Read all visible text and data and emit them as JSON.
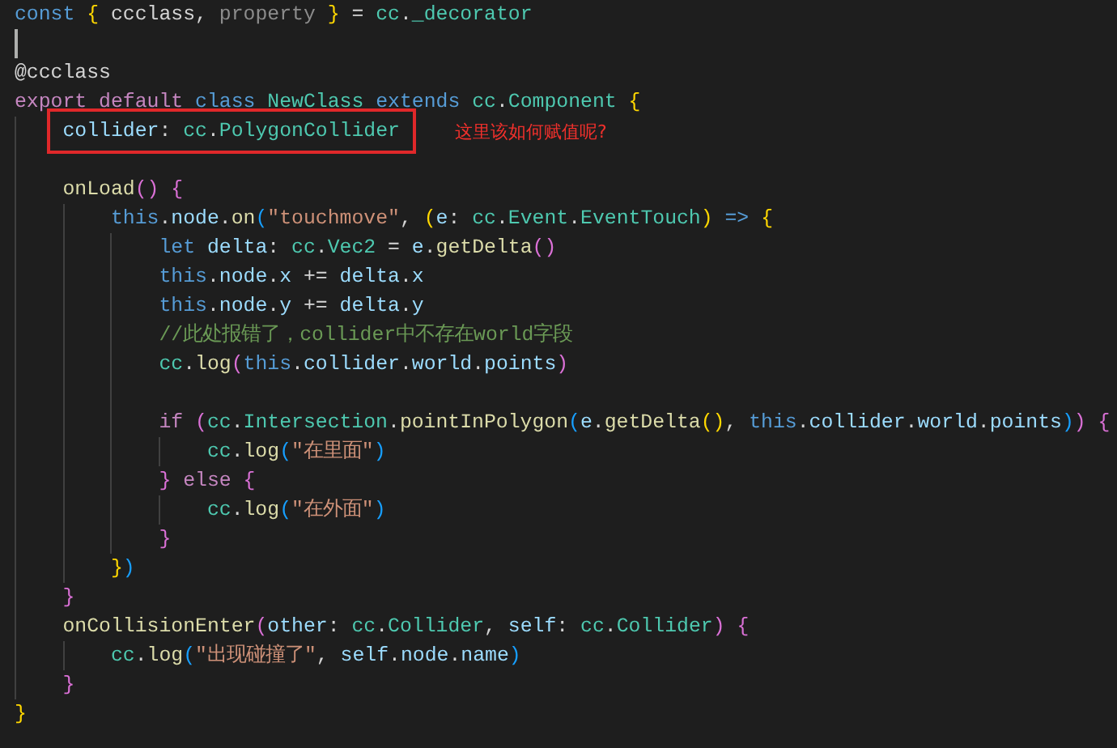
{
  "editor": {
    "lines": [
      {
        "tokens": [
          {
            "kind": "kw",
            "text": "const "
          },
          {
            "kind": "b1",
            "text": "{"
          },
          {
            "kind": "plain",
            "text": " ccclass, "
          },
          {
            "kind": "dim",
            "text": "property"
          },
          {
            "kind": "b1",
            "text": " }"
          },
          {
            "kind": "plain",
            "text": " = "
          },
          {
            "kind": "type",
            "text": "cc"
          },
          {
            "kind": "plain",
            "text": "."
          },
          {
            "kind": "type",
            "text": "_decorator"
          }
        ]
      },
      {
        "cursor": true
      },
      {
        "tokens": [
          {
            "kind": "plain",
            "text": "@ccclass"
          }
        ]
      },
      {
        "tokens": [
          {
            "kind": "ctrl",
            "text": "export default "
          },
          {
            "kind": "kw",
            "text": "class "
          },
          {
            "kind": "type",
            "text": "NewClass "
          },
          {
            "kind": "kw",
            "text": "extends "
          },
          {
            "kind": "type",
            "text": "cc"
          },
          {
            "kind": "plain",
            "text": "."
          },
          {
            "kind": "type",
            "text": "Component "
          },
          {
            "kind": "b1",
            "text": "{"
          }
        ]
      },
      {
        "marked": true,
        "note": "这里该如何赋值呢?",
        "tokens": [
          {
            "kind": "indent"
          },
          {
            "kind": "var",
            "text": "collider"
          },
          {
            "kind": "plain",
            "text": ": "
          },
          {
            "kind": "type",
            "text": "cc"
          },
          {
            "kind": "plain",
            "text": "."
          },
          {
            "kind": "type",
            "text": "PolygonCollider"
          }
        ]
      },
      {
        "tokens": [
          {
            "kind": "indent"
          }
        ]
      },
      {
        "tokens": [
          {
            "kind": "indent"
          },
          {
            "kind": "fn",
            "text": "onLoad"
          },
          {
            "kind": "b2",
            "text": "() {"
          }
        ]
      },
      {
        "tokens": [
          {
            "kind": "indent"
          },
          {
            "kind": "indent"
          },
          {
            "kind": "kw",
            "text": "this"
          },
          {
            "kind": "plain",
            "text": "."
          },
          {
            "kind": "var",
            "text": "node"
          },
          {
            "kind": "plain",
            "text": "."
          },
          {
            "kind": "fn",
            "text": "on"
          },
          {
            "kind": "b3",
            "text": "("
          },
          {
            "kind": "str",
            "text": "\"touchmove\""
          },
          {
            "kind": "plain",
            "text": ", "
          },
          {
            "kind": "b1",
            "text": "("
          },
          {
            "kind": "var",
            "text": "e"
          },
          {
            "kind": "plain",
            "text": ": "
          },
          {
            "kind": "type",
            "text": "cc"
          },
          {
            "kind": "plain",
            "text": "."
          },
          {
            "kind": "type",
            "text": "Event"
          },
          {
            "kind": "plain",
            "text": "."
          },
          {
            "kind": "type",
            "text": "EventTouch"
          },
          {
            "kind": "b1",
            "text": ") "
          },
          {
            "kind": "kw",
            "text": "=> "
          },
          {
            "kind": "b1",
            "text": "{"
          }
        ]
      },
      {
        "tokens": [
          {
            "kind": "indent"
          },
          {
            "kind": "indent"
          },
          {
            "kind": "indent"
          },
          {
            "kind": "kw",
            "text": "let "
          },
          {
            "kind": "var",
            "text": "delta"
          },
          {
            "kind": "plain",
            "text": ": "
          },
          {
            "kind": "type",
            "text": "cc"
          },
          {
            "kind": "plain",
            "text": "."
          },
          {
            "kind": "type",
            "text": "Vec2"
          },
          {
            "kind": "plain",
            "text": " = "
          },
          {
            "kind": "var",
            "text": "e"
          },
          {
            "kind": "plain",
            "text": "."
          },
          {
            "kind": "fn",
            "text": "getDelta"
          },
          {
            "kind": "b2",
            "text": "()"
          }
        ]
      },
      {
        "tokens": [
          {
            "kind": "indent"
          },
          {
            "kind": "indent"
          },
          {
            "kind": "indent"
          },
          {
            "kind": "kw",
            "text": "this"
          },
          {
            "kind": "plain",
            "text": "."
          },
          {
            "kind": "var",
            "text": "node"
          },
          {
            "kind": "plain",
            "text": "."
          },
          {
            "kind": "var",
            "text": "x"
          },
          {
            "kind": "plain",
            "text": " += "
          },
          {
            "kind": "var",
            "text": "delta"
          },
          {
            "kind": "plain",
            "text": "."
          },
          {
            "kind": "var",
            "text": "x"
          }
        ]
      },
      {
        "tokens": [
          {
            "kind": "indent"
          },
          {
            "kind": "indent"
          },
          {
            "kind": "indent"
          },
          {
            "kind": "kw",
            "text": "this"
          },
          {
            "kind": "plain",
            "text": "."
          },
          {
            "kind": "var",
            "text": "node"
          },
          {
            "kind": "plain",
            "text": "."
          },
          {
            "kind": "var",
            "text": "y"
          },
          {
            "kind": "plain",
            "text": " += "
          },
          {
            "kind": "var",
            "text": "delta"
          },
          {
            "kind": "plain",
            "text": "."
          },
          {
            "kind": "var",
            "text": "y"
          }
        ]
      },
      {
        "tokens": [
          {
            "kind": "indent"
          },
          {
            "kind": "indent"
          },
          {
            "kind": "indent"
          },
          {
            "kind": "cmt",
            "text": "//此处报错了，collider中不存在world字段"
          }
        ]
      },
      {
        "tokens": [
          {
            "kind": "indent"
          },
          {
            "kind": "indent"
          },
          {
            "kind": "indent"
          },
          {
            "kind": "type",
            "text": "cc"
          },
          {
            "kind": "plain",
            "text": "."
          },
          {
            "kind": "fn",
            "text": "log"
          },
          {
            "kind": "b2",
            "text": "("
          },
          {
            "kind": "kw",
            "text": "this"
          },
          {
            "kind": "plain",
            "text": "."
          },
          {
            "kind": "var",
            "text": "collider"
          },
          {
            "kind": "plain",
            "text": "."
          },
          {
            "kind": "var",
            "text": "world"
          },
          {
            "kind": "plain",
            "text": "."
          },
          {
            "kind": "var",
            "text": "points"
          },
          {
            "kind": "b2",
            "text": ")"
          }
        ]
      },
      {
        "tokens": [
          {
            "kind": "indent"
          },
          {
            "kind": "indent"
          },
          {
            "kind": "indent"
          }
        ]
      },
      {
        "tokens": [
          {
            "kind": "indent"
          },
          {
            "kind": "indent"
          },
          {
            "kind": "indent"
          },
          {
            "kind": "ctrl",
            "text": "if "
          },
          {
            "kind": "b2",
            "text": "("
          },
          {
            "kind": "type",
            "text": "cc"
          },
          {
            "kind": "plain",
            "text": "."
          },
          {
            "kind": "type",
            "text": "Intersection"
          },
          {
            "kind": "plain",
            "text": "."
          },
          {
            "kind": "fn",
            "text": "pointInPolygon"
          },
          {
            "kind": "b3",
            "text": "("
          },
          {
            "kind": "var",
            "text": "e"
          },
          {
            "kind": "plain",
            "text": "."
          },
          {
            "kind": "fn",
            "text": "getDelta"
          },
          {
            "kind": "b1",
            "text": "()"
          },
          {
            "kind": "plain",
            "text": ", "
          },
          {
            "kind": "kw",
            "text": "this"
          },
          {
            "kind": "plain",
            "text": "."
          },
          {
            "kind": "var",
            "text": "collider"
          },
          {
            "kind": "plain",
            "text": "."
          },
          {
            "kind": "var",
            "text": "world"
          },
          {
            "kind": "plain",
            "text": "."
          },
          {
            "kind": "var",
            "text": "points"
          },
          {
            "kind": "b3",
            "text": ")"
          },
          {
            "kind": "b2",
            "text": ") {"
          }
        ]
      },
      {
        "tokens": [
          {
            "kind": "indent"
          },
          {
            "kind": "indent"
          },
          {
            "kind": "indent"
          },
          {
            "kind": "indent"
          },
          {
            "kind": "type",
            "text": "cc"
          },
          {
            "kind": "plain",
            "text": "."
          },
          {
            "kind": "fn",
            "text": "log"
          },
          {
            "kind": "b3",
            "text": "("
          },
          {
            "kind": "str",
            "text": "\"在里面\""
          },
          {
            "kind": "b3",
            "text": ")"
          }
        ]
      },
      {
        "tokens": [
          {
            "kind": "indent"
          },
          {
            "kind": "indent"
          },
          {
            "kind": "indent"
          },
          {
            "kind": "b2",
            "text": "} "
          },
          {
            "kind": "ctrl",
            "text": "else "
          },
          {
            "kind": "b2",
            "text": "{"
          }
        ]
      },
      {
        "tokens": [
          {
            "kind": "indent"
          },
          {
            "kind": "indent"
          },
          {
            "kind": "indent"
          },
          {
            "kind": "indent"
          },
          {
            "kind": "type",
            "text": "cc"
          },
          {
            "kind": "plain",
            "text": "."
          },
          {
            "kind": "fn",
            "text": "log"
          },
          {
            "kind": "b3",
            "text": "("
          },
          {
            "kind": "str",
            "text": "\"在外面\""
          },
          {
            "kind": "b3",
            "text": ")"
          }
        ]
      },
      {
        "tokens": [
          {
            "kind": "indent"
          },
          {
            "kind": "indent"
          },
          {
            "kind": "indent"
          },
          {
            "kind": "b2",
            "text": "}"
          }
        ]
      },
      {
        "tokens": [
          {
            "kind": "indent"
          },
          {
            "kind": "indent"
          },
          {
            "kind": "b1",
            "text": "}"
          },
          {
            "kind": "b3",
            "text": ")"
          }
        ]
      },
      {
        "tokens": [
          {
            "kind": "indent"
          },
          {
            "kind": "b2",
            "text": "}"
          }
        ]
      },
      {
        "tokens": [
          {
            "kind": "indent"
          },
          {
            "kind": "fn",
            "text": "onCollisionEnter"
          },
          {
            "kind": "b2",
            "text": "("
          },
          {
            "kind": "var",
            "text": "other"
          },
          {
            "kind": "plain",
            "text": ": "
          },
          {
            "kind": "type",
            "text": "cc"
          },
          {
            "kind": "plain",
            "text": "."
          },
          {
            "kind": "type",
            "text": "Collider"
          },
          {
            "kind": "plain",
            "text": ", "
          },
          {
            "kind": "var",
            "text": "self"
          },
          {
            "kind": "plain",
            "text": ": "
          },
          {
            "kind": "type",
            "text": "cc"
          },
          {
            "kind": "plain",
            "text": "."
          },
          {
            "kind": "type",
            "text": "Collider"
          },
          {
            "kind": "b2",
            "text": ") {"
          }
        ]
      },
      {
        "tokens": [
          {
            "kind": "indent"
          },
          {
            "kind": "indent"
          },
          {
            "kind": "type",
            "text": "cc"
          },
          {
            "kind": "plain",
            "text": "."
          },
          {
            "kind": "fn",
            "text": "log"
          },
          {
            "kind": "b3",
            "text": "("
          },
          {
            "kind": "str",
            "text": "\"出现碰撞了\""
          },
          {
            "kind": "plain",
            "text": ", "
          },
          {
            "kind": "var",
            "text": "self"
          },
          {
            "kind": "plain",
            "text": "."
          },
          {
            "kind": "var",
            "text": "node"
          },
          {
            "kind": "plain",
            "text": "."
          },
          {
            "kind": "var",
            "text": "name"
          },
          {
            "kind": "b3",
            "text": ")"
          }
        ]
      },
      {
        "tokens": [
          {
            "kind": "indent"
          },
          {
            "kind": "b2",
            "text": "}"
          }
        ]
      },
      {
        "tokens": [
          {
            "kind": "b1",
            "text": "}"
          }
        ]
      }
    ]
  }
}
